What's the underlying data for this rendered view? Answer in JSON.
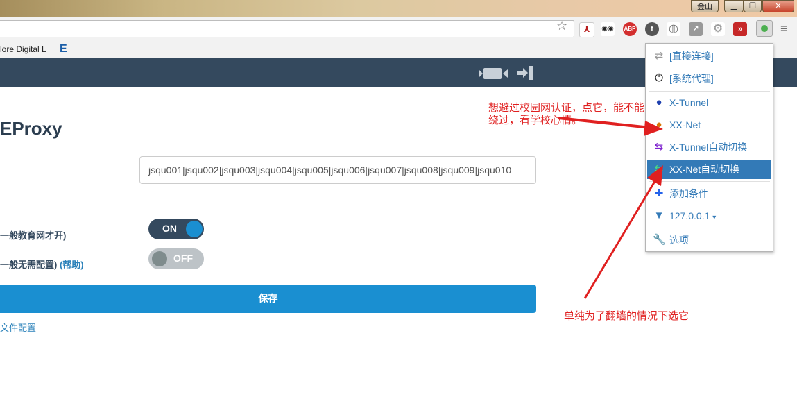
{
  "window": {
    "user_label": "金山",
    "minimize": "▁",
    "maximize": "❐",
    "close": "✕"
  },
  "toolbar": {
    "star_icon": "star-icon",
    "extensions": [
      {
        "name": "pdf-icon",
        "glyph": "⅄",
        "color": "#b71c1c"
      },
      {
        "name": "readerview-icon",
        "glyph": "◉◉",
        "color": "#222222"
      },
      {
        "name": "adblock-icon",
        "glyph": "ABP",
        "color": "#d32f2f"
      },
      {
        "name": "facebook-icon",
        "glyph": "f",
        "color": "#555555"
      },
      {
        "name": "globe-icon",
        "glyph": "◍",
        "color": "#777777"
      },
      {
        "name": "arrow-icon",
        "glyph": "↗",
        "color": "#888888"
      },
      {
        "name": "gear-icon",
        "glyph": "⚙",
        "color": "#999999"
      },
      {
        "name": "forward-icon",
        "glyph": "⏩",
        "color": "#c62828"
      },
      {
        "name": "proxy-switch-icon",
        "glyph": "●",
        "color": "#4caf50"
      }
    ],
    "menu_icon": "≡"
  },
  "bookmarks": {
    "item_label": "lore Digital L",
    "item_icon": "E"
  },
  "page": {
    "title": "EProxy",
    "gateway_value": "jsqu001|jsqu002|jsqu003|jsqu004|jsqu005|jsqu006|jsqu007|jsqu008|jsqu009|jsqu010",
    "row1_label": "一般教育网才开)",
    "row2_label": "一般无需配置)",
    "row2_help": "(帮助)",
    "switch1": "ON",
    "switch2": "OFF",
    "save_label": "保存",
    "config_link": "文件配置"
  },
  "popup": {
    "items": [
      {
        "label": "[直接连接]",
        "icon": "⇄",
        "color": "#999999"
      },
      {
        "label": "[系统代理]",
        "icon": "⏻",
        "color": "#222222"
      },
      {
        "label": "X-Tunnel",
        "icon": "◐",
        "color": "#1e40af"
      },
      {
        "label": "XX-Net",
        "icon": "◑",
        "color": "#d97706"
      },
      {
        "label": "X-Tunnel自动切换",
        "icon": "⇆",
        "color": "#7e22ce"
      },
      {
        "label": "XX-Net自动切换",
        "icon": "⇆",
        "color": "#16a34a"
      },
      {
        "label": "添加条件",
        "icon": "✚",
        "color": "#2563eb"
      },
      {
        "label": "127.0.0.1",
        "icon": "▼",
        "color": "#337ab7"
      },
      {
        "label": "选项",
        "icon": "🔧",
        "color": "#337ab7"
      }
    ]
  },
  "annotations": {
    "top_note_line1": "想避过校园网认证，点它，能不能",
    "top_note_line2": "绕过，看学校心情。",
    "bottom_note": "单纯为了翻墙的情况下选它"
  }
}
